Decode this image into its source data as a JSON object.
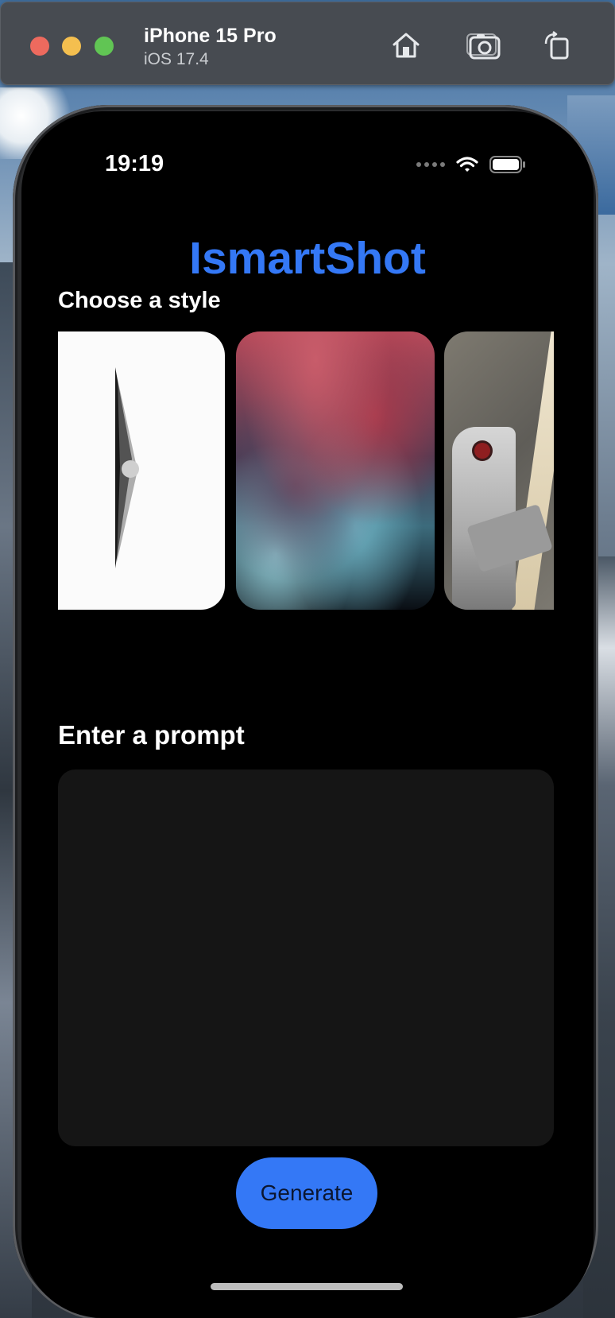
{
  "simulator": {
    "device_name": "iPhone 15 Pro",
    "os_version": "iOS 17.4",
    "buttons": [
      "home-icon",
      "screenshot-icon",
      "rotate-icon"
    ]
  },
  "status_bar": {
    "time": "19:19",
    "icons": [
      "cellular-icon",
      "wifi-icon",
      "battery-icon"
    ]
  },
  "app": {
    "title": "IsmartShot",
    "accent_color": "#3478f6",
    "style_section_label": "Choose a style",
    "styles": [
      {
        "name": "minimal-sketch-style"
      },
      {
        "name": "fluid-art-style"
      },
      {
        "name": "robot-photo-style"
      }
    ],
    "prompt_section_label": "Enter a prompt",
    "prompt_value": "",
    "generate_label": "Generate"
  }
}
